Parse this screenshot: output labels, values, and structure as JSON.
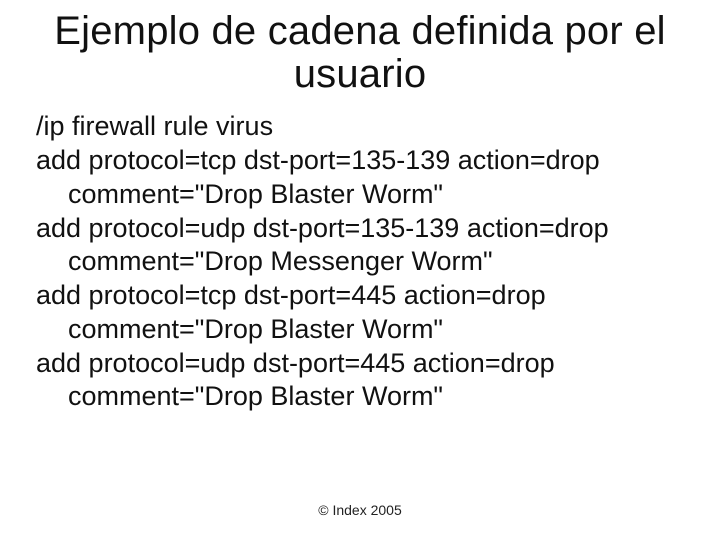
{
  "title": "Ejemplo de cadena definida por el usuario",
  "body": {
    "l0": "/ip firewall rule virus",
    "l1": "add protocol=tcp dst-port=135-139 action=drop",
    "l1c": "comment=\"Drop Blaster Worm\"",
    "l2": "add protocol=udp dst-port=135-139 action=drop",
    "l2c": "comment=\"Drop Messenger Worm\"",
    "l3": "add protocol=tcp dst-port=445 action=drop",
    "l3c": "comment=\"Drop Blaster Worm\"",
    "l4": "add protocol=udp dst-port=445 action=drop",
    "l4c": "comment=\"Drop Blaster Worm\""
  },
  "footer": "© Index 2005"
}
